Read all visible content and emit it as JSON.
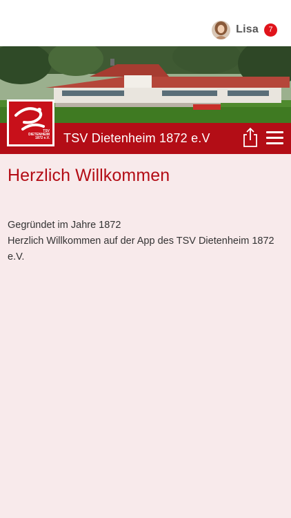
{
  "user": {
    "name": "Lisa",
    "notification_count": "7"
  },
  "header": {
    "club_name": "TSV Dietenheim 1872 e.V",
    "logo_text_line1": "TSV",
    "logo_text_line2": "DIETENHEIM",
    "logo_text_line3": "1872 e.V."
  },
  "main": {
    "title": "Herzlich Willkommen",
    "paragraphs": [
      "Gegründet im Jahre 1872",
      "Herzlich Willkommen auf der App des TSV Dietenheim 1872 e.V."
    ]
  },
  "icons": {
    "share": "share-icon",
    "menu": "hamburger-menu-icon"
  },
  "colors": {
    "brand_red": "#b30d16",
    "badge_red": "#e0141b",
    "page_background": "#f8eaeb"
  }
}
